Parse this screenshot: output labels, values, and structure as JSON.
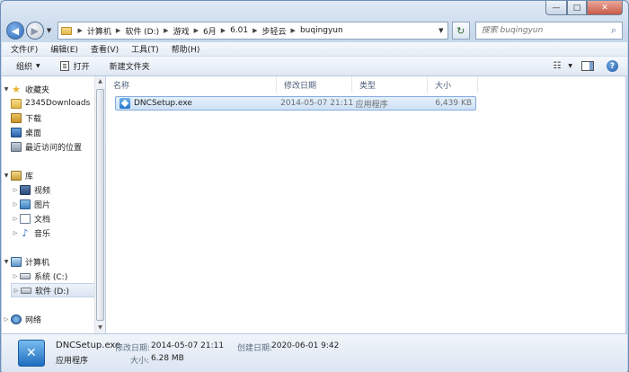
{
  "window": {
    "caption_min": "—",
    "caption_max": "□",
    "caption_close": "✕"
  },
  "address": {
    "crumbs": [
      "计算机",
      "软件 (D:)",
      "游戏",
      "6月",
      "6.01",
      "步轻云",
      "buqingyun"
    ]
  },
  "search": {
    "placeholder": "搜索 buqingyun"
  },
  "menu": {
    "items": [
      "文件(F)",
      "编辑(E)",
      "查看(V)",
      "工具(T)",
      "帮助(H)"
    ]
  },
  "toolbar": {
    "organize": "组织",
    "open": "打开",
    "new_folder": "新建文件夹"
  },
  "nav": {
    "favorites": "收藏夹",
    "fav_items": [
      "2345Downloads",
      "下载",
      "桌面",
      "最近访问的位置"
    ],
    "library": "库",
    "lib_items": [
      "视频",
      "图片",
      "文档",
      "音乐"
    ],
    "computer": "计算机",
    "drives": [
      "系统 (C:)",
      "软件 (D:)"
    ],
    "network": "网络"
  },
  "columns": {
    "name": "名称",
    "date": "修改日期",
    "type": "类型",
    "size": "大小"
  },
  "files": [
    {
      "name": "DNCSetup.exe",
      "date": "2014-05-07 21:11",
      "type": "应用程序",
      "size": "6,439 KB"
    }
  ],
  "details": {
    "name": "DNCSetup.exe",
    "type": "应用程序",
    "modified_label": "修改日期:",
    "modified": "2014-05-07 21:11",
    "created_label": "创建日期:",
    "created": "2020-06-01 9:42",
    "size_label": "大小:",
    "size": "6.28 MB"
  }
}
